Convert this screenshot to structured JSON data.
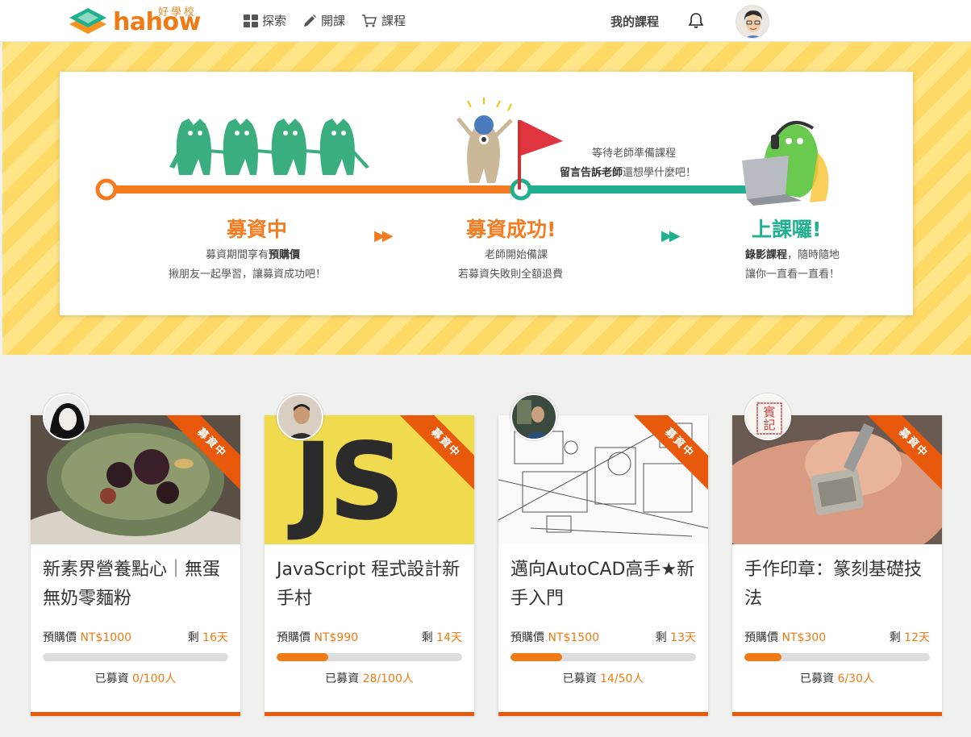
{
  "header": {
    "logo_text": "hahow",
    "logo_sub": "好學校",
    "nav": [
      {
        "label": "探索",
        "icon": "grid-icon"
      },
      {
        "label": "開課",
        "icon": "pencil-icon"
      },
      {
        "label": "課程",
        "icon": "cart-icon"
      }
    ],
    "my_courses": "我的課程",
    "bell_icon": "bell-icon"
  },
  "hero": {
    "stage1": {
      "title": "募資中",
      "line1_pre": "募資期間享有",
      "line1_bold": "預購價",
      "line2": "揪朋友一起學習，讓募資成功吧！"
    },
    "stage2": {
      "title": "募資成功!",
      "line1": "老師開始備課",
      "line2": "若募資失敗則全額退費"
    },
    "wait": {
      "line1": "等待老師準備課程",
      "line2_bold": "留言告訴老師",
      "line2_rest": "還想學什麼吧！"
    },
    "stage3": {
      "title": "上課囉!",
      "line1_bold": "錄影課程",
      "line1_rest": "，隨時隨地",
      "line2": "讓你一直看一直看！"
    },
    "arrow": "▶▶",
    "colors": {
      "orange": "#f47b20",
      "green": "#20b08f"
    }
  },
  "courses": [
    {
      "title": "新素界營養點心｜無蛋無奶零麵粉",
      "price_label": "預購價",
      "price": "NT$1000",
      "days_label": "剩",
      "days": "16天",
      "raised_label": "已募資",
      "raised": "0/100人",
      "progress": 0,
      "ribbon": "募資中"
    },
    {
      "title": "JavaScript 程式設計新手村",
      "price_label": "預購價",
      "price": "NT$990",
      "days_label": "剩",
      "days": "14天",
      "raised_label": "已募資",
      "raised": "28/100人",
      "progress": 0.28,
      "ribbon": "募資中"
    },
    {
      "title": "邁向AutoCAD高手★新手入門",
      "price_label": "預購價",
      "price": "NT$1500",
      "days_label": "剩",
      "days": "13天",
      "raised_label": "已募資",
      "raised": "14/50人",
      "progress": 0.28,
      "ribbon": "募資中"
    },
    {
      "title": "手作印章：篆刻基礎技法",
      "price_label": "預購價",
      "price": "NT$300",
      "days_label": "剩",
      "days": "12天",
      "raised_label": "已募資",
      "raised": "6/30人",
      "progress": 0.2,
      "ribbon": "募資中"
    }
  ],
  "js_logo": "JS",
  "seal_text": "賓記"
}
